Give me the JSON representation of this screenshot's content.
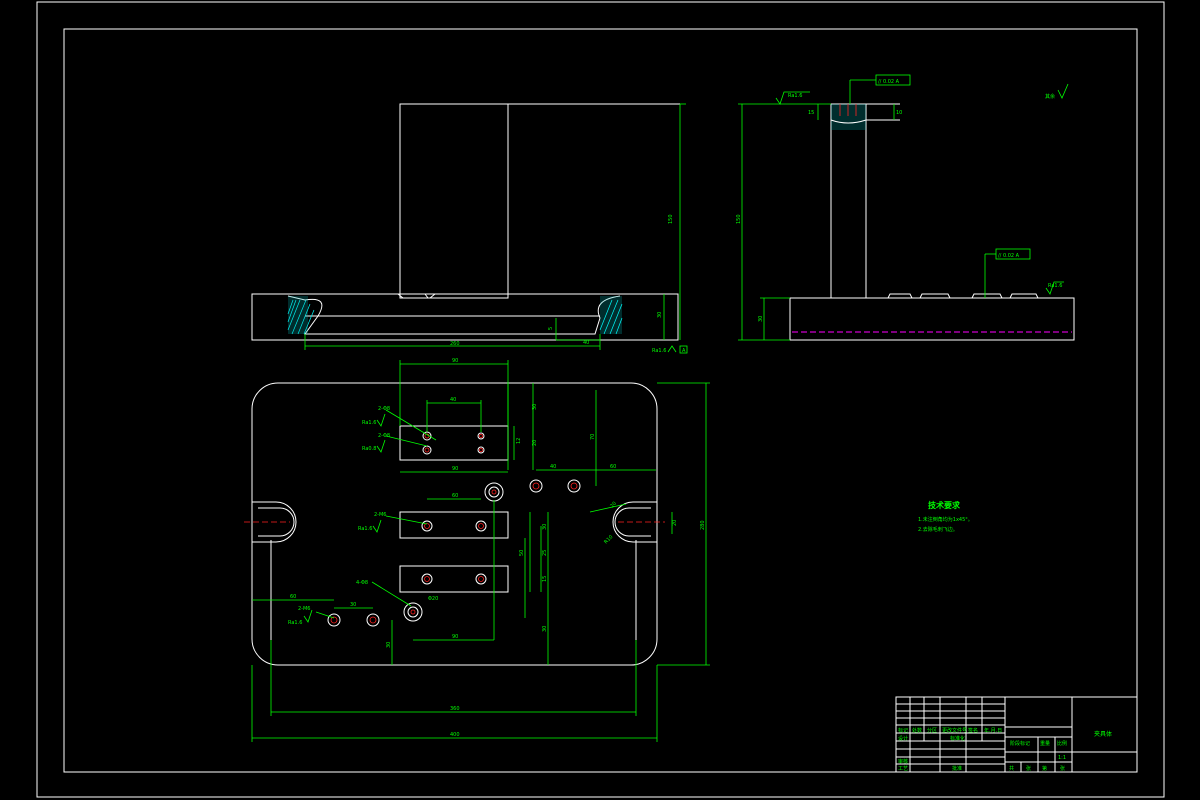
{
  "drawing": {
    "title_block": {
      "part_name": "夹具体",
      "scale": "1:1",
      "header_cells": [
        "标记",
        "处数",
        "分区",
        "更改文件号",
        "签名",
        "年.月.日"
      ],
      "row_labels": [
        "设计",
        "审核",
        "工艺"
      ],
      "standard_label": "标准化",
      "stage_label": "阶段标记",
      "weight_label": "重量",
      "scale_label": "比例",
      "sheet_cells": [
        "共",
        "张",
        "第",
        "张"
      ],
      "approve_label": "批准"
    },
    "tech_requirements": {
      "heading": "技术要求",
      "lines": [
        "1.未注倒角均为1x45°。",
        "2.去除毛刺飞边。"
      ]
    },
    "general_roughness": "其余",
    "tolerances": {
      "parallel_top": "// 0.02 A",
      "parallel_side": "// 0.02 A",
      "datum": "A"
    },
    "roughness_labels": {
      "side_top": "Ra1.6",
      "side_right": "Ra1.6",
      "front_bottom": "Ra1.6",
      "plan_1": "Ra1.6",
      "plan_2": "Ra0.8",
      "plan_3": "Ra1.6",
      "plan_4": "Ra1.6"
    },
    "hole_callouts": {
      "h1": "2-Φ8",
      "h2": "2-Φ8",
      "h3": "2-M6",
      "h4": "4-Φ8",
      "h5": "2-M6",
      "h6": "4-Φ10",
      "h7": "Φ20"
    },
    "dimensions": {
      "front_height": "150",
      "front_base_height": "30",
      "front_width": "260",
      "front_depth": "5",
      "front_slot": "40",
      "side_height": "150",
      "side_base": "30",
      "side_top_a": "15",
      "side_top_b": "10",
      "plan_top_1": "90",
      "plan_top_2": "40",
      "plan_right_1": "70",
      "plan_right_2": "60",
      "plan_right_3": "40",
      "plan_vert_1": "30",
      "plan_vert_2": "12",
      "plan_vert_3": "20",
      "plan_mid_1": "90",
      "plan_mid_2": "60",
      "plan_mid_3": "50",
      "plan_mid_4": "30",
      "plan_mid_5": "25",
      "plan_mid_6": "15",
      "plan_low_1": "90",
      "plan_low_2": "60",
      "plan_low_3": "30",
      "plan_low_4": "30",
      "plan_low_5": "20",
      "plan_slot_w": "20",
      "plan_slot_r": "R10",
      "plan_inner_w": "360",
      "plan_outer_w": "400",
      "plan_height": "280",
      "plan_low_6": "30"
    }
  }
}
